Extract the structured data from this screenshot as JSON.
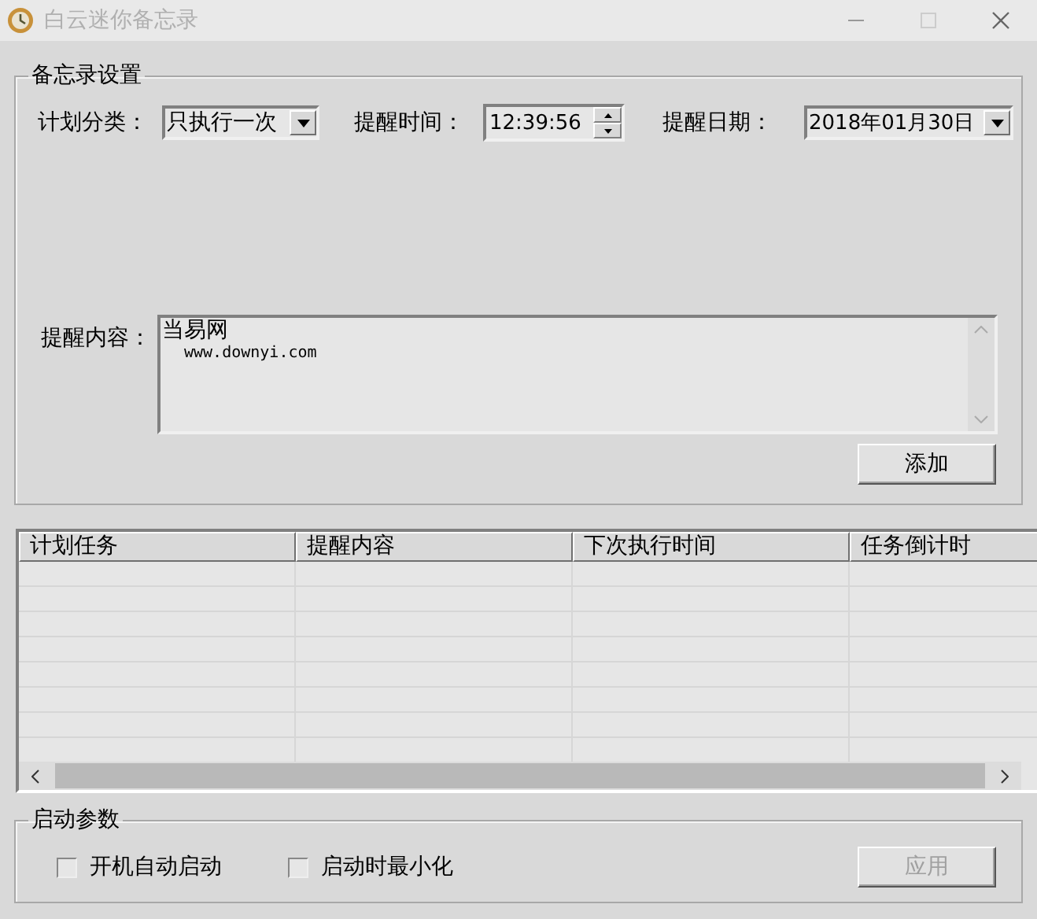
{
  "window": {
    "title": "白云迷你备忘录"
  },
  "settings": {
    "title": "备忘录设置",
    "plan_type": {
      "label": "计划分类：",
      "value": "只执行一次"
    },
    "remind_time": {
      "label": "提醒时间：",
      "value": "12:39:56"
    },
    "remind_date": {
      "label": "提醒日期：",
      "value": "2018年01月30日"
    },
    "content": {
      "label": "提醒内容：",
      "title": "当易网",
      "body": "www.downyi.com"
    },
    "add_button": "添加"
  },
  "table": {
    "columns": [
      "计划任务",
      "提醒内容",
      "下次执行时间",
      "任务倒计时"
    ]
  },
  "startup": {
    "title": "启动参数",
    "options": [
      {
        "label": "开机自动启动",
        "checked": false
      },
      {
        "label": "启动时最小化",
        "checked": false
      }
    ],
    "apply_button": {
      "label": "应用",
      "disabled": true
    }
  }
}
